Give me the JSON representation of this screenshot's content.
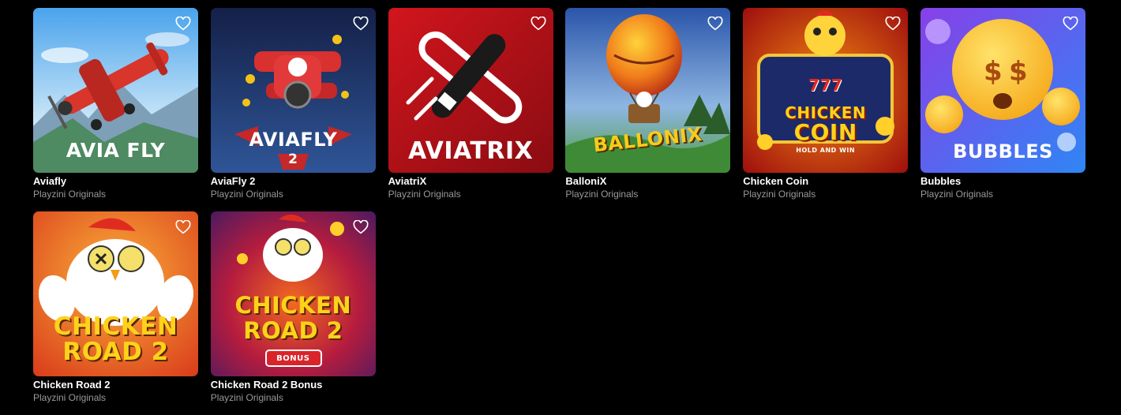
{
  "games": [
    {
      "title": "Aviafly",
      "provider": "Playzini Originals",
      "logo": "AVIA FLY",
      "art": "aviafly",
      "colors": {
        "bg1": "#5fb0ef",
        "bg2": "#cfe9f7",
        "accent": "#d8352b"
      }
    },
    {
      "title": "AviaFly 2",
      "provider": "Playzini Originals",
      "logo": "AVIAFLY",
      "logo_sub": "2",
      "art": "aviafly2",
      "colors": {
        "bg1": "#16244f",
        "bg2": "#2f4f8e",
        "accent": "#d93030"
      }
    },
    {
      "title": "AviatriX",
      "provider": "Playzini Originals",
      "logo": "AVIATRIX",
      "art": "aviatrix",
      "colors": {
        "bg1": "#c4151c",
        "bg2": "#8e0d12",
        "accent": "#ffffff"
      }
    },
    {
      "title": "BalloniX",
      "provider": "Playzini Originals",
      "logo": "BALLONIX",
      "art": "ballonix",
      "colors": {
        "bg1": "#3c6cc0",
        "bg2": "#5fb25a",
        "accent": "#f2c21a"
      }
    },
    {
      "title": "Chicken Coin",
      "provider": "Playzini Originals",
      "logo": "CHICKEN",
      "logo2": "COIN",
      "logo_top": "777",
      "logo_sub": "HOLD AND WIN",
      "art": "chickencoin",
      "colors": {
        "bg1": "#b41412",
        "bg2": "#f08a12",
        "accent": "#ffd21a"
      }
    },
    {
      "title": "Bubbles",
      "provider": "Playzini Originals",
      "logo": "BUBBLES",
      "art": "bubbles",
      "colors": {
        "bg1": "#3f7cf4",
        "bg2": "#8a3fe9",
        "accent": "#ffc629"
      }
    },
    {
      "title": "Chicken Road 2",
      "provider": "Playzini Originals",
      "logo": "CHICKEN",
      "logo2": "ROAD 2",
      "art": "chickenroad2",
      "colors": {
        "bg1": "#e0431e",
        "bg2": "#f59a2a",
        "accent": "#ffd21a"
      }
    },
    {
      "title": "Chicken Road 2 Bonus",
      "provider": "Playzini Originals",
      "logo": "CHICKEN",
      "logo2": "ROAD 2",
      "logo_sub": "BONUS",
      "art": "chickenroad2bonus",
      "colors": {
        "bg1": "#3a1a68",
        "bg2": "#c21f3a",
        "accent": "#ffd21a"
      }
    }
  ],
  "icons": {
    "favorite": "heart-outline-icon"
  }
}
